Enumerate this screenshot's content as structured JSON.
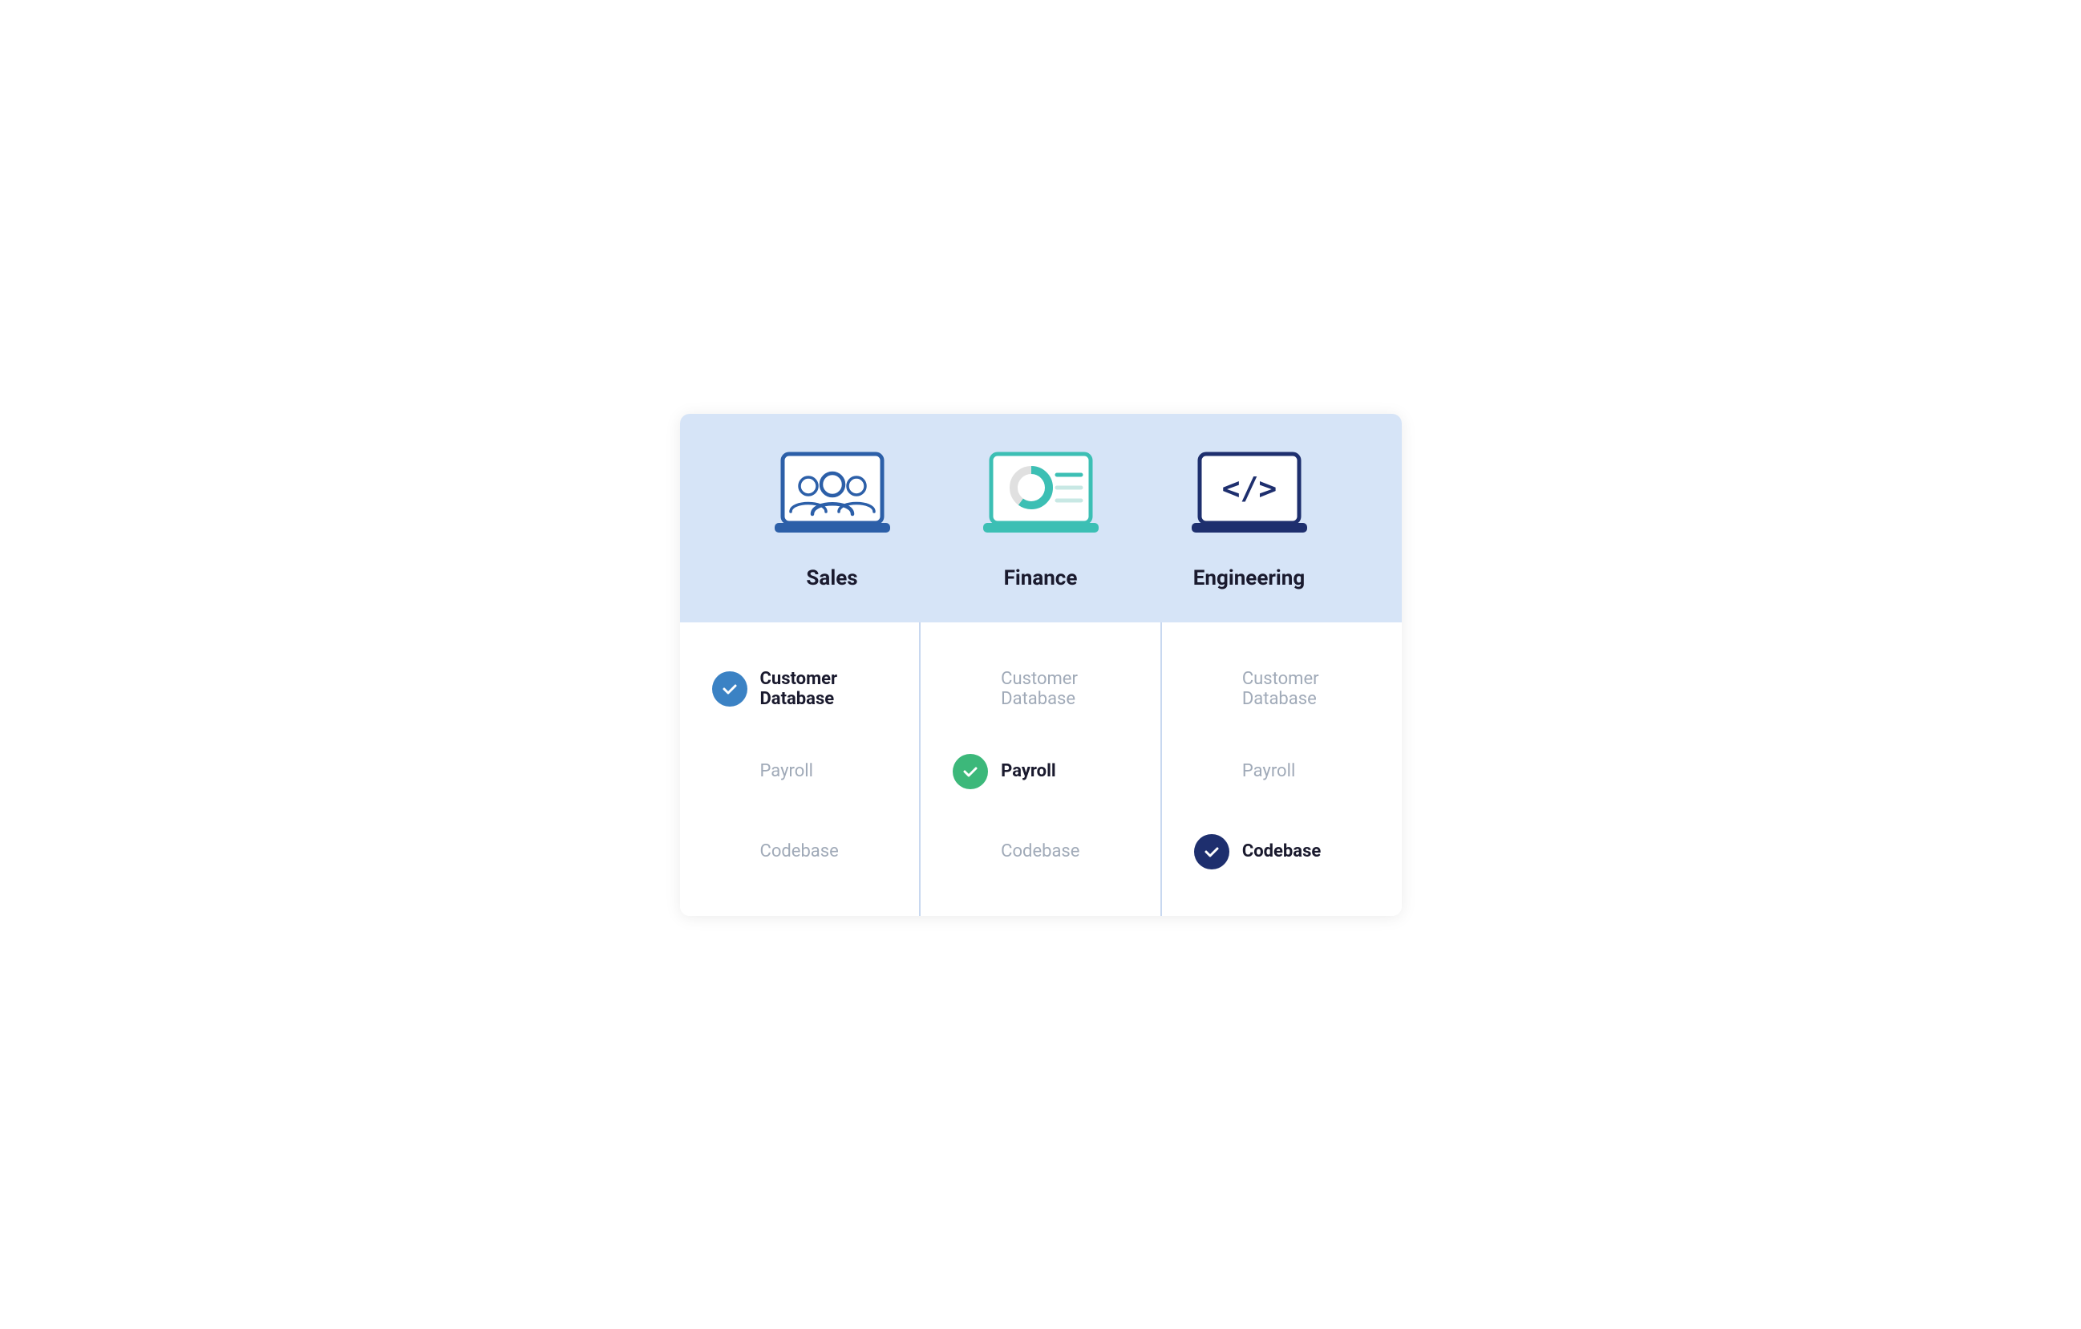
{
  "departments": [
    {
      "id": "sales",
      "label": "Sales",
      "icon_type": "users",
      "icon_color": "#2c5fa8",
      "screen_color": "#2c5fa8"
    },
    {
      "id": "finance",
      "label": "Finance",
      "icon_type": "chart",
      "icon_color": "#3cbfb4",
      "screen_color": "#3cbfb4"
    },
    {
      "id": "engineering",
      "label": "Engineering",
      "icon_type": "code",
      "icon_color": "#1e2f6e",
      "screen_color": "#1e2f6e"
    }
  ],
  "items": [
    {
      "id": "customer-database",
      "label": "Customer Database",
      "active_in": "sales",
      "badge_color": "blue"
    },
    {
      "id": "payroll",
      "label": "Payroll",
      "active_in": "finance",
      "badge_color": "green"
    },
    {
      "id": "codebase",
      "label": "Codebase",
      "active_in": "engineering",
      "badge_color": "navy"
    }
  ],
  "colors": {
    "header_bg": "#d6e4f7",
    "divider": "#c8d8f0",
    "check_blue": "#3b82c4",
    "check_green": "#3cb87a",
    "check_navy": "#1e2f6e",
    "text_active": "#1a1a2e",
    "text_inactive": "#a0aab8"
  }
}
